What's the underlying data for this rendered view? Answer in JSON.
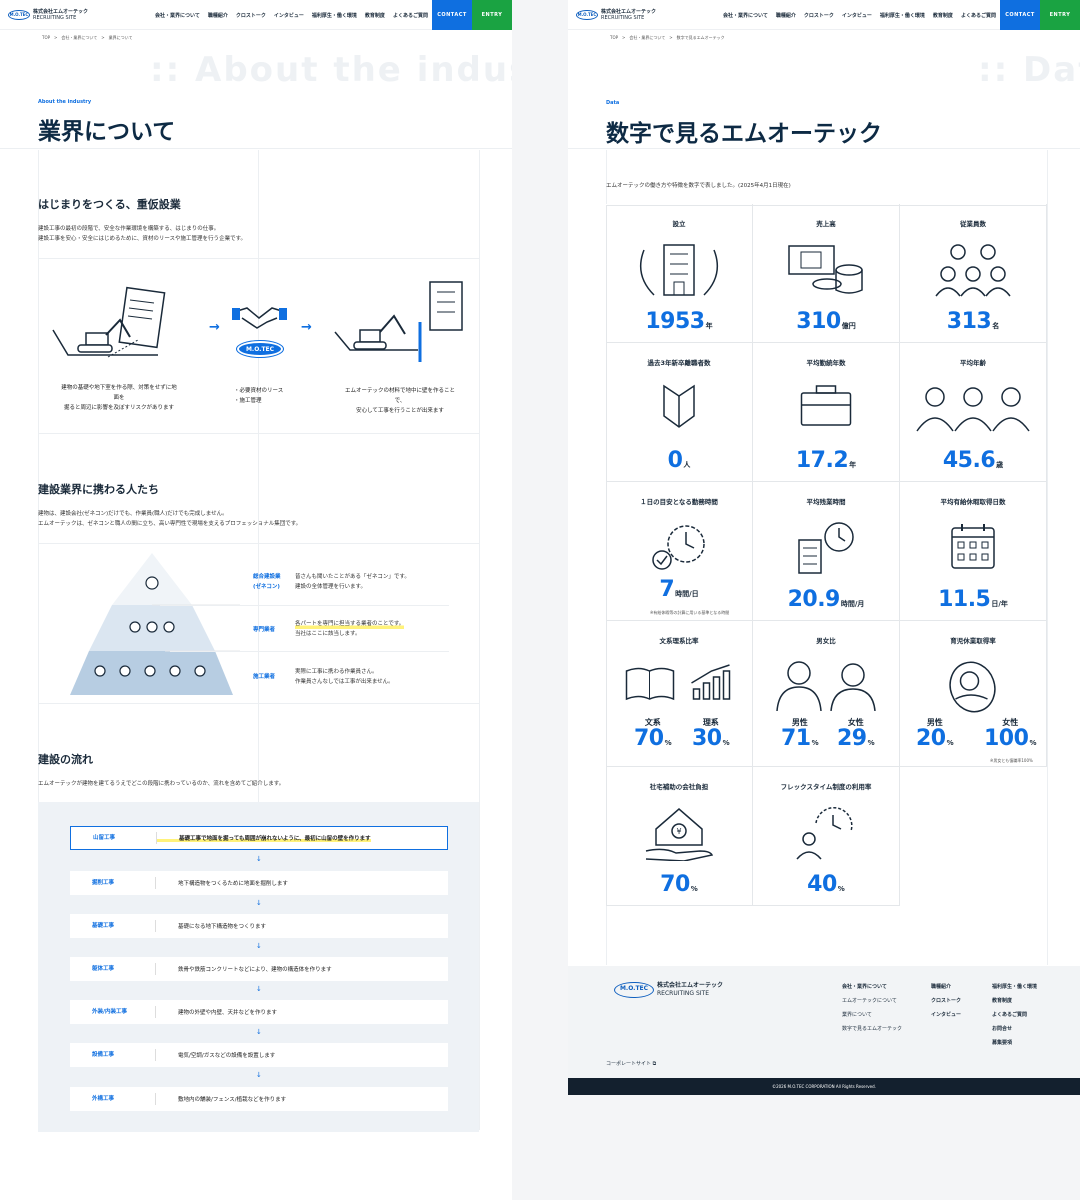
{
  "brand": {
    "logo_text": "M.O.TEC",
    "company": "株式会社エムオーテック",
    "site": "RECRUITING SITE"
  },
  "nav": [
    "会社・業界について",
    "職種紹介",
    "クロストーク",
    "インタビュー",
    "福利厚生・働く環境",
    "教育制度",
    "よくあるご質問"
  ],
  "cta": {
    "contact": "CONTACT",
    "entry": "ENTRY"
  },
  "left": {
    "breadcrumb": "TOP　>　会社・業界について　>　業界について",
    "bg_text": ":: About the industry",
    "eyebrow": "About the industry",
    "title": "業界について",
    "s1": {
      "heading": "はじまりをつくる、重仮設業",
      "body1": "建設工事の最初の段階で、安全な作業環境を構築する、はじまりの仕事。",
      "body2": "建設工事を安心・安全にはじめるために、資材のリースや施工管理を行う企業です。",
      "cap1a": "建物の基礎や地下室を作る際、対策をせずに地",
      "cap1b": "面を",
      "cap1c": "掘ると周辺に影響を及ぼすリスクがあります",
      "cap2a": "・必要資材のリース",
      "cap2b": "・施工管理",
      "cap3a": "エムオーテックの材料で地中に壁を作ること",
      "cap3b": "で、",
      "cap3c": "安心して工事を行うことが出来ます"
    },
    "s2": {
      "heading": "建設業界に携わる人たち",
      "body1": "建物は、建設会社(ゼネコン)だけでも、作業員(職人)だけでも完成しません。",
      "body2": "エムオーテックは、ゼネコンと職人の間に立ち、高い専門性で現場を支えるプロフェッショナル集団です。",
      "tiers": [
        {
          "label1": "総合建設業",
          "label2": "(ゼネコン)",
          "d1": "皆さんも聞いたことがある「ゼネコン」です。",
          "d2": "建設の全体管理を行います。"
        },
        {
          "label1": "専門業者",
          "label2": "",
          "d1": "各パートを専門に担当する業者のことです。",
          "d2": "当社はここに該当します。"
        },
        {
          "label1": "施工業者",
          "label2": "",
          "d1": "実際に工事に携わる作業員さん。",
          "d2": "作業員さんなしでは工事が出来ません。"
        }
      ]
    },
    "s3": {
      "heading": "建設の流れ",
      "body": "エムオーテックが建物を建てるうえでどこの段階に携わっているのか、流れを含めてご紹介します。",
      "steps": [
        {
          "label": "山留工事",
          "desc": "基礎工事で地面を掘っても周囲が崩れないように、最初に山留の壁を作ります"
        },
        {
          "label": "掘削工事",
          "desc": "地下構造物をつくるために地面を掘削します"
        },
        {
          "label": "基礎工事",
          "desc": "基礎になる地下構造物をつくります"
        },
        {
          "label": "躯体工事",
          "desc": "鉄骨や鉄筋コンクリートなどにより、建物の構造体を作ります"
        },
        {
          "label": "外装/内装工事",
          "desc": "建物の外壁や内壁、天井などを作ります"
        },
        {
          "label": "設備工事",
          "desc": "電気/空調/ガスなどの設備を設置します"
        },
        {
          "label": "外構工事",
          "desc": "敷地内の舗装/フェンス/植栽などを作ります"
        }
      ],
      "arrow": "↓"
    }
  },
  "right": {
    "breadcrumb": "TOP　>　会社・業界について　>　数字で見るエムオーテック",
    "bg_text": ":: Data",
    "eyebrow": "Data",
    "title": "数字で見るエムオーテック",
    "lead": "エムオーテックの働き方や特徴を数字で表しました。(2025年4月1日現在)",
    "stats": [
      {
        "title": "設立",
        "value": "1953",
        "unit": "年",
        "icon": "building-laurel-icon"
      },
      {
        "title": "売上高",
        "value": "310",
        "unit": "億円",
        "icon": "money-icon"
      },
      {
        "title": "従業員数",
        "value": "313",
        "unit": "名",
        "icon": "people-group-icon"
      },
      {
        "title": "過去3年新卒離職者数",
        "value": "0",
        "unit": "人",
        "icon": "beginner-mark-icon"
      },
      {
        "title": "平均勤続年数",
        "value": "17.2",
        "unit": "年",
        "icon": "briefcase-icon"
      },
      {
        "title": "平均年齢",
        "value": "45.6",
        "unit": "歳",
        "icon": "three-people-icon"
      },
      {
        "title": "１日の目安となる勤務時間",
        "value": "7",
        "unit": "時間/日",
        "icon": "clock-check-icon",
        "note": "※有給休暇等の計算に用いる基準となる時間"
      },
      {
        "title": "平均残業時間",
        "value": "20.9",
        "unit": "時間/月",
        "icon": "office-clock-icon"
      },
      {
        "title": "平均有給休暇取得日数",
        "value": "11.5",
        "unit": "日/年",
        "icon": "calendar-icon"
      }
    ],
    "ratio1": {
      "title": "文系理系比率",
      "a_label": "文系",
      "a": "70",
      "b_label": "理系",
      "b": "30",
      "unit": "%"
    },
    "ratio2": {
      "title": "男女比",
      "a_label": "男性",
      "a": "71",
      "b_label": "女性",
      "b": "29",
      "unit": "%"
    },
    "ratio3": {
      "title": "育児休業取得率",
      "a_label": "男性",
      "a": "20",
      "b_label": "女性",
      "b": "100",
      "unit": "%",
      "note": "※男女とも復職率100%"
    },
    "housing": {
      "title": "社宅補助の会社負担",
      "value": "70",
      "unit": "%"
    },
    "flex": {
      "title": "フレックスタイム制度の利用率",
      "value": "40",
      "unit": "%"
    },
    "footer": {
      "col1": [
        "会社・業界について",
        "エムオーテックについて",
        "業界について",
        "数字で見るエムオーテック"
      ],
      "col2": [
        "職種紹介",
        "クロストーク",
        "インタビュー"
      ],
      "col3": [
        "福利厚生・働く環境",
        "教育制度",
        "よくあるご質問",
        "お問合せ",
        "募集要項"
      ],
      "corp": "コーポレートサイト",
      "copyright": "©2026 M.O.TEC CORPORATION All Rights Reserved."
    }
  }
}
